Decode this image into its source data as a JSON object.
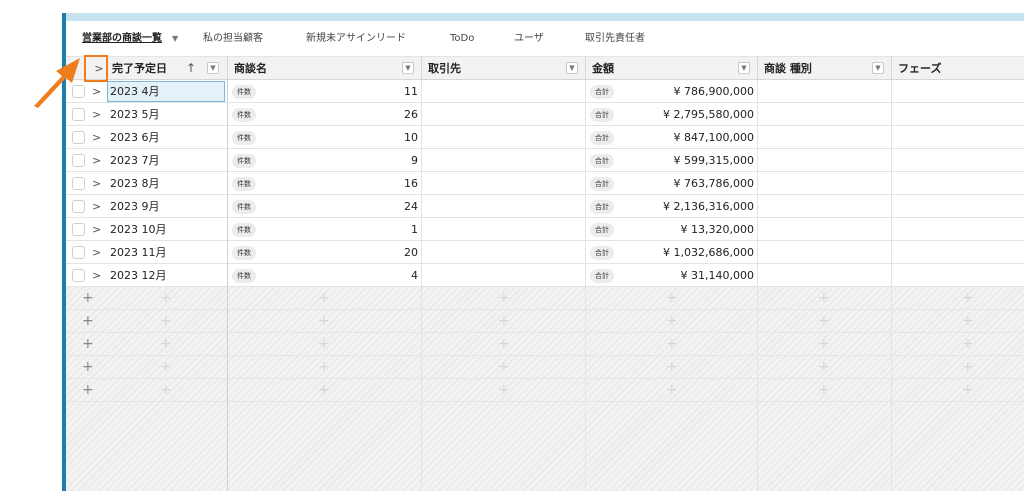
{
  "tabs": [
    {
      "label": "営業部の商談一覧",
      "active": true
    },
    {
      "label": "私の担当顧客",
      "active": false
    },
    {
      "label": "新規未アサインリード",
      "active": false
    },
    {
      "label": "ToDo",
      "active": false
    },
    {
      "label": "ユーザ",
      "active": false
    },
    {
      "label": "取引先責任者",
      "active": false
    }
  ],
  "columns": {
    "close_date": "完了予定日",
    "opportunity_name": "商談名",
    "account": "取引先",
    "amount": "金額",
    "opportunity_type": "商談 種別",
    "phase": "フェーズ"
  },
  "badges": {
    "count": "件数",
    "total": "合計"
  },
  "rows": [
    {
      "date": "2023 4月",
      "count": "11",
      "amount": "¥ 786,900,000"
    },
    {
      "date": "2023 5月",
      "count": "26",
      "amount": "¥ 2,795,580,000"
    },
    {
      "date": "2023 6月",
      "count": "10",
      "amount": "¥ 847,100,000"
    },
    {
      "date": "2023 7月",
      "count": "9",
      "amount": "¥ 599,315,000"
    },
    {
      "date": "2023 8月",
      "count": "16",
      "amount": "¥ 763,786,000"
    },
    {
      "date": "2023 9月",
      "count": "24",
      "amount": "¥ 2,136,316,000"
    },
    {
      "date": "2023 10月",
      "count": "1",
      "amount": "¥ 13,320,000"
    },
    {
      "date": "2023 11月",
      "count": "20",
      "amount": "¥ 1,032,686,000"
    },
    {
      "date": "2023 12月",
      "count": "4",
      "amount": "¥ 31,140,000"
    }
  ],
  "colors": {
    "accent_blue": "#1e7fa6",
    "highlight_orange": "#ef7d1d",
    "selection_blue": "#7ab8d9"
  }
}
